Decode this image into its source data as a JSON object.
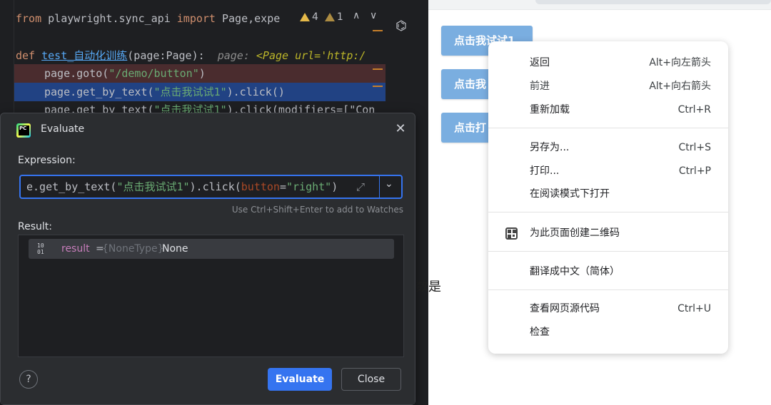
{
  "editor": {
    "line1": {
      "kw_from": "from",
      "module": " playwright.sync_api ",
      "kw_import": "import",
      "names": " Page,expe"
    },
    "warnings": {
      "warn_count": "4",
      "weak_count": "1"
    },
    "line3": {
      "kw_def": "def",
      "fn_name": "test_自动化训练",
      "params": "(page:Page):",
      "hint_label": "page:",
      "hint_value": "<Page url='http:/"
    },
    "line4": {
      "prefix": "page.goto(",
      "arg": "\"/demo/button\"",
      "suffix": ")"
    },
    "line5": {
      "prefix": "page.get_by_text(",
      "arg": "\"点击我试试1\"",
      "suffix": ").click()"
    },
    "line6": {
      "prefix": "page.get_by_text(",
      "arg": "\"点击我试试1\"",
      "suffix": ").click(modifiers=[\"Con"
    }
  },
  "dialog": {
    "title": "Evaluate",
    "expression_label": "Expression:",
    "expression": {
      "part1": "e.get_by_text(",
      "part2": "\"点击我试试1\"",
      "part3": ").click(",
      "part4": "button",
      "part5": "=",
      "part6": "\"right\"",
      "part7": ")"
    },
    "watch_hint": "Use Ctrl+Shift+Enter to add to Watches",
    "result_label": "Result:",
    "result": {
      "name": "result",
      "eq": " = ",
      "type": "{NoneType}",
      "value": "None"
    },
    "help": "?",
    "evaluate_button": "Evaluate",
    "close_button": "Close"
  },
  "browser": {
    "buttons": [
      "点击我试试1",
      "点击我",
      "点击打"
    ],
    "partial_text": "数是"
  },
  "context_menu": {
    "items": [
      {
        "label": "返回",
        "shortcut": "Alt+向左箭头"
      },
      {
        "label": "前进",
        "shortcut": "Alt+向右箭头"
      },
      {
        "label": "重新加载",
        "shortcut": "Ctrl+R"
      },
      {
        "label": "另存为...",
        "shortcut": "Ctrl+S"
      },
      {
        "label": "打印...",
        "shortcut": "Ctrl+P"
      },
      {
        "label": "在阅读模式下打开",
        "shortcut": ""
      },
      {
        "label": "为此页面创建二维码",
        "shortcut": ""
      },
      {
        "label": "翻译成中文（简体）",
        "shortcut": ""
      },
      {
        "label": "查看网页源代码",
        "shortcut": "Ctrl+U"
      },
      {
        "label": "检查",
        "shortcut": ""
      }
    ]
  },
  "colors": {
    "ide_bg": "#1e1f22",
    "accent_blue": "#3574f0",
    "page_button": "#7aaee0"
  }
}
